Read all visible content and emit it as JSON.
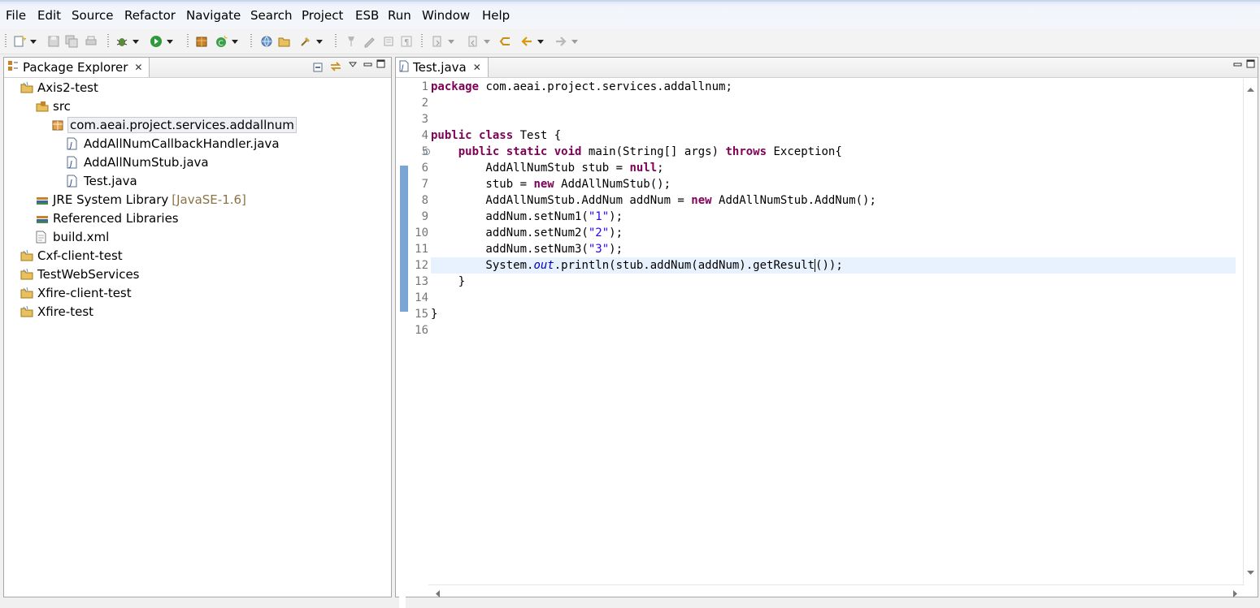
{
  "menu": [
    "File",
    "Edit",
    "Source",
    "Refactor",
    "Navigate",
    "Search",
    "Project",
    "ESB",
    "Run",
    "Window",
    "Help"
  ],
  "explorer": {
    "tab_label": "Package Explorer",
    "tree": [
      {
        "label": "Axis2-test",
        "icon": "project-icon",
        "indent": 0
      },
      {
        "label": "src",
        "icon": "source-folder-icon",
        "indent": 1
      },
      {
        "label": "com.aeai.project.services.addallnum",
        "icon": "package-icon",
        "indent": 2,
        "selected": true
      },
      {
        "label": "AddAllNumCallbackHandler.java",
        "icon": "java-file-icon",
        "indent": 3
      },
      {
        "label": "AddAllNumStub.java",
        "icon": "java-file-icon",
        "indent": 3
      },
      {
        "label": "Test.java",
        "icon": "java-file-icon",
        "indent": 3
      },
      {
        "label": "JRE System Library",
        "decoration": "[JavaSE-1.6]",
        "icon": "library-icon",
        "indent": 1
      },
      {
        "label": "Referenced Libraries",
        "icon": "library-icon",
        "indent": 1
      },
      {
        "label": "build.xml",
        "icon": "xml-file-icon",
        "indent": 1
      },
      {
        "label": "Cxf-client-test",
        "icon": "project-icon",
        "indent": 0
      },
      {
        "label": "TestWebServices",
        "icon": "project-icon",
        "indent": 0
      },
      {
        "label": "Xfire-client-test",
        "icon": "project-icon",
        "indent": 0
      },
      {
        "label": "Xfire-test",
        "icon": "project-icon",
        "indent": 0
      }
    ]
  },
  "editor": {
    "tab_label": "Test.java",
    "current_line": 12,
    "lines": [
      [
        [
          "kw",
          "package"
        ],
        [
          "t",
          " com.aeai.project.services.addallnum;"
        ]
      ],
      [],
      [],
      [
        [
          "kw",
          "public"
        ],
        [
          "t",
          " "
        ],
        [
          "kw",
          "class"
        ],
        [
          "t",
          " Test {"
        ]
      ],
      [
        [
          "t",
          "    "
        ],
        [
          "kw",
          "public"
        ],
        [
          "t",
          " "
        ],
        [
          "kw",
          "static"
        ],
        [
          "t",
          " "
        ],
        [
          "kw",
          "void"
        ],
        [
          "t",
          " main(String[] args) "
        ],
        [
          "kw",
          "throws"
        ],
        [
          "t",
          " Exception{"
        ]
      ],
      [
        [
          "t",
          "        AddAllNumStub stub = "
        ],
        [
          "kw",
          "null"
        ],
        [
          "t",
          ";"
        ]
      ],
      [
        [
          "t",
          "        stub = "
        ],
        [
          "kw",
          "new"
        ],
        [
          "t",
          " AddAllNumStub();"
        ]
      ],
      [
        [
          "t",
          "        AddAllNumStub.AddNum addNum = "
        ],
        [
          "kw",
          "new"
        ],
        [
          "t",
          " AddAllNumStub.AddNum();"
        ]
      ],
      [
        [
          "t",
          "        addNum.setNum1("
        ],
        [
          "str",
          "\"1\""
        ],
        [
          "t",
          ");"
        ]
      ],
      [
        [
          "t",
          "        addNum.setNum2("
        ],
        [
          "str",
          "\"2\""
        ],
        [
          "t",
          ");"
        ]
      ],
      [
        [
          "t",
          "        addNum.setNum3("
        ],
        [
          "str",
          "\"3\""
        ],
        [
          "t",
          ");"
        ]
      ],
      [
        [
          "t",
          "        System."
        ],
        [
          "fld",
          "out"
        ],
        [
          "t",
          ".println(stub.addNum(addNum).getResult"
        ],
        [
          "caret",
          "("
        ],
        [
          "t",
          "));"
        ]
      ],
      [
        [
          "t",
          "    }"
        ]
      ],
      [],
      [
        [
          "t",
          "}"
        ]
      ],
      []
    ]
  }
}
